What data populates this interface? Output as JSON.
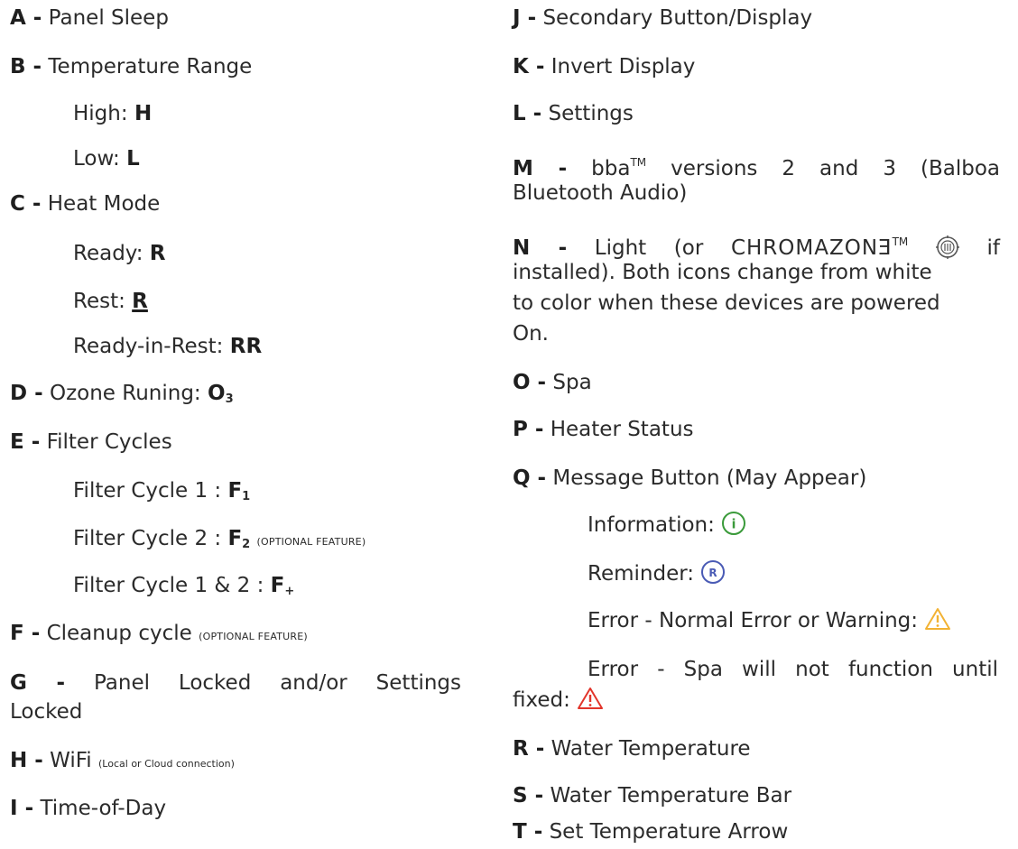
{
  "left": {
    "a": {
      "key": "A -",
      "text": "Panel Sleep"
    },
    "b": {
      "key": "B -",
      "text": "Temperature Range"
    },
    "b_high": {
      "label": "High:",
      "value": "H"
    },
    "b_low": {
      "label": "Low:",
      "value": "L"
    },
    "c": {
      "key": "C -",
      "text": "Heat Mode"
    },
    "c_ready": {
      "label": "Ready:",
      "value": "R"
    },
    "c_rest": {
      "label": "Rest:",
      "value": "R"
    },
    "c_rir": {
      "label": "Ready-in-Rest:",
      "value": "RR"
    },
    "d": {
      "key": "D -",
      "text": "Ozone Runing:",
      "value": "O",
      "sub": "3"
    },
    "e": {
      "key": "E -",
      "text": "Filter Cycles"
    },
    "e_f1": {
      "label": "Filter Cycle 1 :",
      "value": "F",
      "sub": "1"
    },
    "e_f2": {
      "label": "Filter Cycle 2 :",
      "value": "F",
      "sub": "2",
      "note": "(OPTIONAL FEATURE)"
    },
    "e_f12": {
      "label": "Filter Cycle 1 & 2 :",
      "value": "F",
      "sub": "+"
    },
    "f": {
      "key": "F -",
      "text": "Cleanup cycle",
      "note": "(OPTIONAL FEATURE)"
    },
    "g": {
      "key": "G -",
      "text": "Panel Locked and/or Settings",
      "text2": "Locked"
    },
    "h": {
      "key": "H -",
      "text": "WiFi",
      "note": "(Local or Cloud connection)"
    },
    "i": {
      "key": "I -",
      "text": "Time-of-Day"
    }
  },
  "right": {
    "j": {
      "key": "J -",
      "text": "Secondary Button/Display"
    },
    "k": {
      "key": "K -",
      "text": "Invert Display"
    },
    "l": {
      "key": "L -",
      "text": "Settings"
    },
    "m": {
      "key": "M -",
      "text_a": "bba",
      "tm": "TM",
      "text_b": "versions 2 and 3 (Balboa",
      "text2": "Bluetooth Audio)"
    },
    "n": {
      "key": "N -",
      "text_a": "Light (or",
      "brand": "CHROMAZONƎ",
      "tm": "TM",
      "text_b": "if",
      "text2": "installed). Both icons change from white",
      "text3": "to color when these devices are powered",
      "text4": "On."
    },
    "o": {
      "key": "O -",
      "text": "Spa"
    },
    "p": {
      "key": "P -",
      "text": "Heater Status"
    },
    "q": {
      "key": "Q -",
      "text": "Message Button (May Appear)"
    },
    "q_info": {
      "label": "Information:",
      "icon": "i"
    },
    "q_rem": {
      "label": "Reminder:",
      "icon": "R"
    },
    "q_err1": {
      "label": "Error - Normal Error or Warning:"
    },
    "q_err2": {
      "label": "Error - Spa will not function until",
      "label2": "fixed:"
    },
    "r": {
      "key": "R -",
      "text": "Water Temperature"
    },
    "s": {
      "key": "S -",
      "text": "Water Temperature Bar"
    },
    "t": {
      "key": "T -",
      "text": "Set Temperature Arrow"
    }
  },
  "colors": {
    "info": "#3a9a3a",
    "reminder": "#4a5bb5",
    "warning": "#f2b233",
    "error": "#e2352b"
  }
}
